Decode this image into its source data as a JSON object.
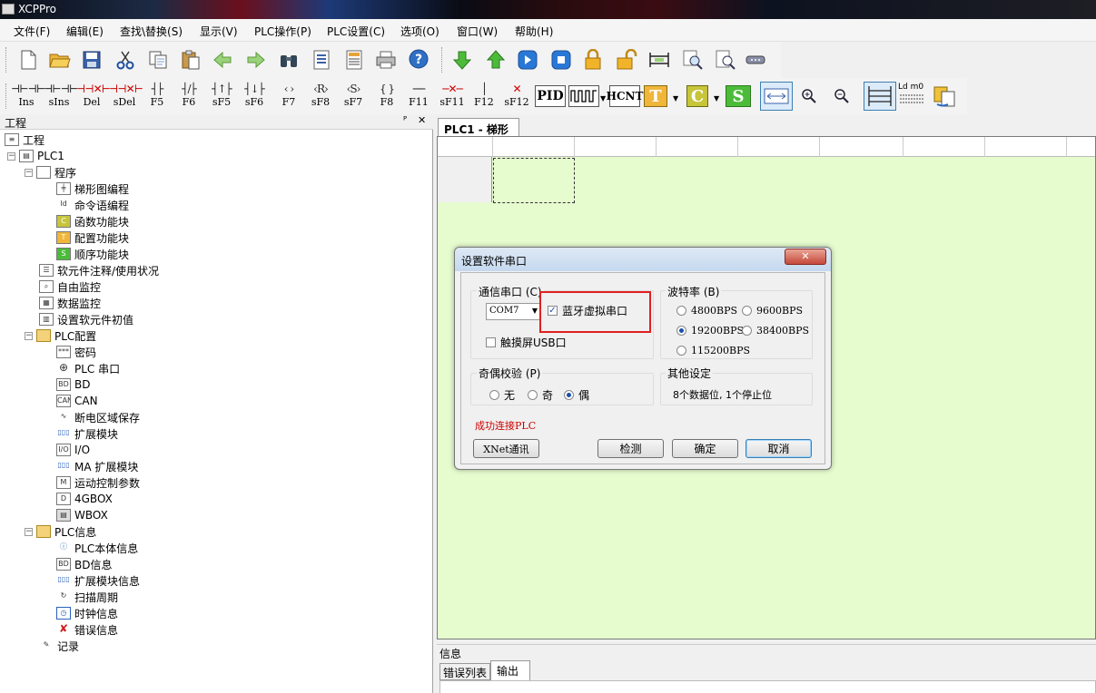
{
  "app": {
    "title": "XCPPro"
  },
  "menu": [
    "文件(F)",
    "编辑(E)",
    "查找\\替换(S)",
    "显示(V)",
    "PLC操作(P)",
    "PLC设置(C)",
    "选项(O)",
    "窗口(W)",
    "帮助(H)"
  ],
  "toolbar2": {
    "ladder_buttons": [
      {
        "symbol": "⊣⊢⊣⊢",
        "label": "Ins"
      },
      {
        "symbol": "⊣⊢⊣⊢",
        "label": "sIns"
      },
      {
        "symbol": "⊣⊣✕⊢",
        "label": "Del"
      },
      {
        "symbol": "⊣⊣✕⊢",
        "label": "sDel"
      },
      {
        "symbol": "┤├",
        "label": "F5"
      },
      {
        "symbol": "┤/├",
        "label": "F6"
      },
      {
        "symbol": "┤↑├",
        "label": "sF5"
      },
      {
        "symbol": "┤↓├",
        "label": "sF6"
      },
      {
        "symbol": "‹ ›",
        "label": "F7"
      },
      {
        "symbol": "‹R›",
        "label": "sF8"
      },
      {
        "symbol": "‹S›",
        "label": "sF7"
      },
      {
        "symbol": "{ }",
        "label": "F8"
      },
      {
        "symbol": "──",
        "label": "F11"
      },
      {
        "symbol": "─✕─",
        "label": "sF11"
      },
      {
        "symbol": "│",
        "label": "F12"
      },
      {
        "symbol": "✕",
        "label": "sF12"
      }
    ],
    "pid_label": "PID",
    "hcnt_label": "HCNT",
    "t_label": "T",
    "c_label": "C",
    "s_label": "S",
    "ldm_label": "Ld m0"
  },
  "left_panel": {
    "title": "工程",
    "pin": "ᴾ",
    "close": "✕",
    "tree": [
      {
        "label": "工程"
      },
      {
        "label": "PLC1"
      },
      {
        "label": "程序"
      },
      {
        "label": "梯形图编程"
      },
      {
        "label": "命令语编程"
      },
      {
        "label": "函数功能块"
      },
      {
        "label": "配置功能块"
      },
      {
        "label": "顺序功能块"
      },
      {
        "label": "软元件注释/使用状况"
      },
      {
        "label": "自由监控"
      },
      {
        "label": "数据监控"
      },
      {
        "label": "设置软元件初值"
      },
      {
        "label": "PLC配置"
      },
      {
        "label": "密码"
      },
      {
        "label": "PLC 串口"
      },
      {
        "label": "BD"
      },
      {
        "label": "CAN"
      },
      {
        "label": "断电区域保存"
      },
      {
        "label": "扩展模块"
      },
      {
        "label": "I/O"
      },
      {
        "label": "MA 扩展模块"
      },
      {
        "label": "运动控制参数"
      },
      {
        "label": "4GBOX"
      },
      {
        "label": "WBOX"
      },
      {
        "label": "PLC信息"
      },
      {
        "label": "PLC本体信息"
      },
      {
        "label": "BD信息"
      },
      {
        "label": "扩展模块信息"
      },
      {
        "label": "扫描周期"
      },
      {
        "label": "时钟信息"
      },
      {
        "label": "错误信息"
      },
      {
        "label": "记录"
      }
    ]
  },
  "editor": {
    "tab_label": "PLC1 - 梯形图"
  },
  "info": {
    "title": "信息",
    "tabs": [
      "错误列表",
      "输出"
    ]
  },
  "dialog": {
    "title": "设置软件串口",
    "close": "✕",
    "comm_port_title": "通信串口 (C)",
    "port_value": "COM7",
    "bluetooth_label": "蓝牙虚拟串口",
    "bluetooth_checked": true,
    "touchscreen_label": "触摸屏USB口",
    "touchscreen_checked": false,
    "baud_title": "波特率 (B)",
    "baud_options": [
      "4800BPS",
      "9600BPS",
      "19200BPS",
      "38400BPS",
      "115200BPS"
    ],
    "baud_selected": "19200BPS",
    "parity_title": "奇偶校验 (P)",
    "parity_options": [
      "无",
      "奇",
      "偶"
    ],
    "parity_selected": "偶",
    "other_title": "其他设定",
    "other_value": "8个数据位, 1个停止位",
    "status_text": "成功连接PLC",
    "status_color": "#d00000",
    "xnet_button": "XNet通讯",
    "detect_button": "检测",
    "ok_button": "确定",
    "cancel_button": "取消"
  },
  "colors": {
    "ladder_bg": "#e6fccf",
    "highlight_box": "#e02020"
  }
}
